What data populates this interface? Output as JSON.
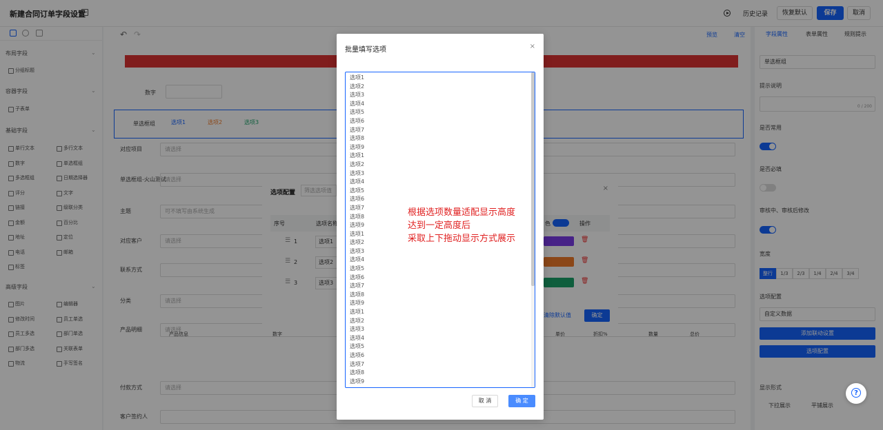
{
  "header": {
    "title": "新建合同订单字段设置",
    "history_label": "历史记录",
    "restore_label": "恢复默认",
    "save_label": "保存",
    "cancel_label": "取消"
  },
  "left_panel": {
    "groups": [
      {
        "title": "布局字段",
        "items": [
          "分组标题"
        ]
      },
      {
        "title": "容器字段",
        "items": [
          "子表单"
        ]
      },
      {
        "title": "基础字段",
        "items": [
          "单行文本",
          "多行文本",
          "数字",
          "单选框组",
          "多选框组",
          "日期选择器",
          "评分",
          "文字",
          "链接",
          "级联分类",
          "金额",
          "百分比",
          "地址",
          "定位",
          "电话",
          "邮箱",
          "标签"
        ]
      },
      {
        "title": "高级字段",
        "items": [
          "图片",
          "编辑器",
          "修改时间",
          "员工单选",
          "员工多选",
          "部门单选",
          "部门多选",
          "关联表单",
          "物流",
          "手写签名"
        ]
      }
    ]
  },
  "canvas": {
    "preview_label": "预览",
    "clear_label": "清空",
    "number_label": "数字",
    "radio_group_label": "单选框组",
    "radio_options": [
      "选项1",
      "选项2",
      "选项3"
    ],
    "rows": [
      {
        "label": "对应项目",
        "placeholder": "请选择"
      },
      {
        "label": "单选框组-火山测试",
        "placeholder": "请选择"
      },
      {
        "label": "主题",
        "placeholder": "可不填写由系统生成"
      },
      {
        "label": "对应客户",
        "placeholder": "请选择"
      },
      {
        "label": "联系方式",
        "placeholder": ""
      },
      {
        "label": "分类",
        "placeholder": "请选择"
      },
      {
        "label": "产品明细",
        "placeholder": "请选择"
      },
      {
        "label": "付款方式",
        "placeholder": "请选择"
      },
      {
        "label": "客户签约人",
        "placeholder": ""
      }
    ],
    "product_cols": [
      "产品信息",
      "数字",
      "单价",
      "折扣%",
      "数量",
      "总价"
    ]
  },
  "back_dialog": {
    "title": "选项配置",
    "filter_placeholder": "筛选选项值",
    "col_index": "序号",
    "col_name": "选项名称",
    "col_color": "色",
    "col_action": "操作",
    "rows": [
      {
        "index": "1",
        "name": "选项1",
        "color": "#7a3be8"
      },
      {
        "index": "2",
        "name": "选项2",
        "color": "#f07a2a"
      },
      {
        "index": "3",
        "name": "选项3",
        "color": "#1aa36a"
      }
    ],
    "clear_default_label": "清除默认值",
    "confirm_label": "确定"
  },
  "right_panel": {
    "tabs": [
      "字段属性",
      "表单属性",
      "规则提示"
    ],
    "field_name_value": "单选框组",
    "hint_label": "提示说明",
    "hint_count": "0 / 200",
    "common_label": "是否常用",
    "required_label": "是否必填",
    "edit_label": "审核中、审核后修改",
    "width_label": "宽度",
    "width_options": [
      "整行",
      "1/3",
      "2/3",
      "1/4",
      "2/4",
      "3/4"
    ],
    "option_config_label": "选项配置",
    "option_source_value": "自定义数据",
    "add_linkage_label": "添加联动设置",
    "option_config_button": "选项配置",
    "display_label": "显示形式",
    "display_options": [
      "下拉展示",
      "平铺展示"
    ]
  },
  "modal": {
    "title": "批量填写选项",
    "close_glyph": "×",
    "lines": [
      "选项1",
      "选项2",
      "选项3",
      "选项4",
      "选项5",
      "选项6",
      "选项7",
      "选项8",
      "选项9",
      "选项1",
      "选项2",
      "选项3",
      "选项4",
      "选项5",
      "选项6",
      "选项7",
      "选项8",
      "选项9",
      "选项1",
      "选项2",
      "选项3",
      "选项4",
      "选项5",
      "选项6",
      "选项7",
      "选项8",
      "选项9",
      "选项1",
      "选项2",
      "选项3",
      "选项4",
      "选项5",
      "选项6",
      "选项7",
      "选项8",
      "选项9"
    ],
    "annotation": [
      "根据选项数量适配显示高度",
      "达到一定高度后",
      "采取上下拖动显示方式展示"
    ],
    "cancel_label": "取 消",
    "ok_label": "确 定"
  }
}
